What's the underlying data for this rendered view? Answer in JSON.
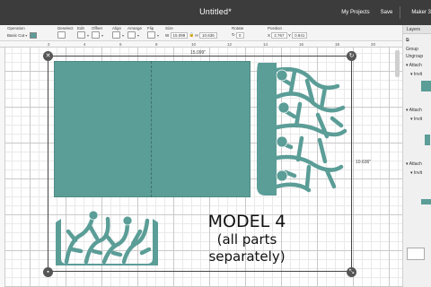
{
  "window": {
    "title": "Untitled*",
    "my_projects": "My Projects",
    "save": "Save",
    "machine": "Maker 3"
  },
  "toolbar": {
    "operation_label": "Operation",
    "operation_value": "Basic Cut",
    "deselect_label": "Deselect",
    "edit_label": "Edit",
    "offset_label": "Offset",
    "align_label": "Align",
    "arrange_label": "Arrange",
    "flip_label": "Flip",
    "size_label": "Size",
    "size_w_prefix": "W",
    "size_w": "15.099",
    "size_h_prefix": "H",
    "size_h": "10.636",
    "rotate_label": "Rotate",
    "rotate_value": "0",
    "position_label": "Position",
    "pos_x_prefix": "X",
    "pos_x": "2.767",
    "pos_y_prefix": "Y",
    "pos_y": "0.841",
    "color_accent": "#5b9d97"
  },
  "ruler": {
    "ticks": [
      "2",
      "4",
      "6",
      "8",
      "10",
      "12",
      "14",
      "16",
      "18",
      "20"
    ]
  },
  "canvas": {
    "width_dim": "15.099\"",
    "height_dim": "10.636\"",
    "overlay_line1": "MODEL 4",
    "overlay_line2": "(all parts separately)"
  },
  "panel": {
    "header": "Layers",
    "group": "Group",
    "ungroup": "Ungroup",
    "sections": [
      {
        "label": "Attach",
        "item": "Invit"
      },
      {
        "label": "Attach",
        "item": "Invit"
      },
      {
        "label": "Attach",
        "item": "Invit"
      }
    ]
  }
}
